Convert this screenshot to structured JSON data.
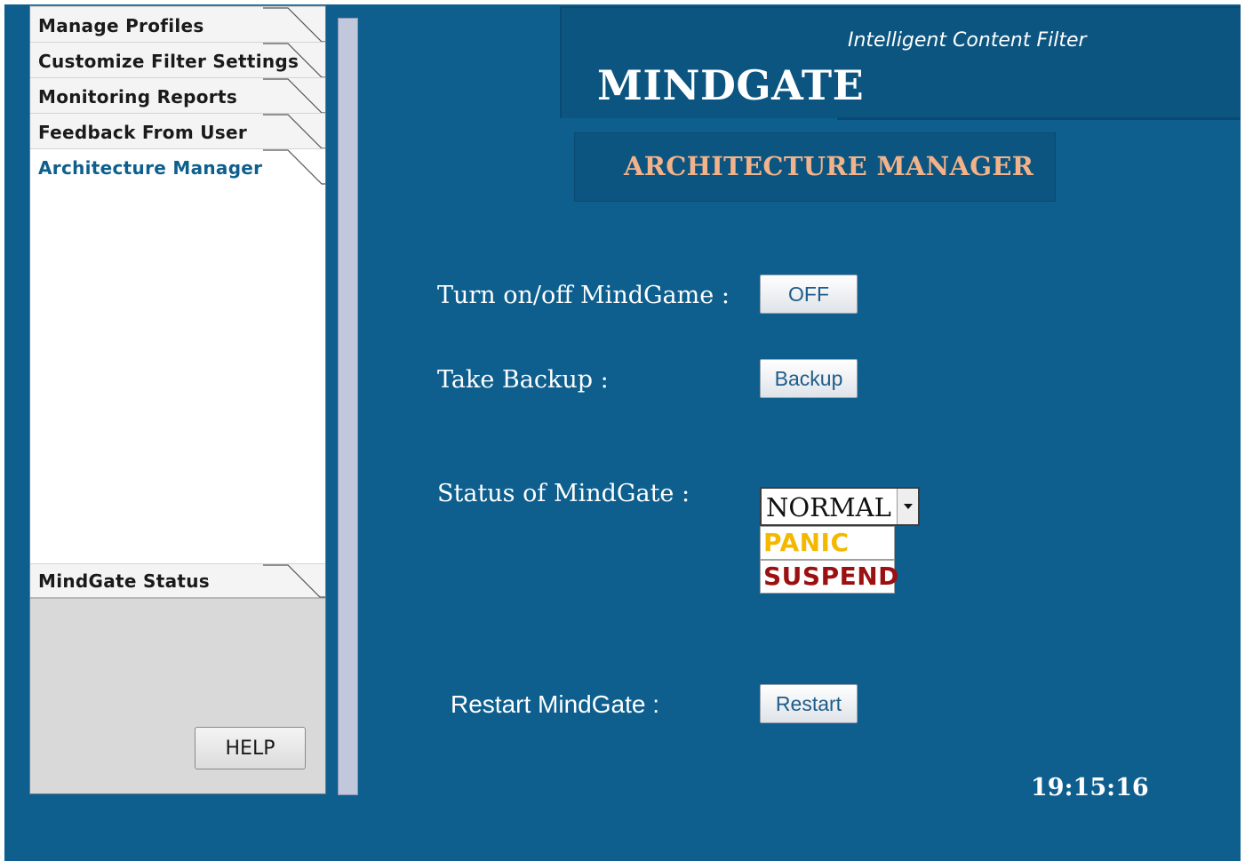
{
  "sidebar": {
    "nav": [
      {
        "label": "Manage Profiles"
      },
      {
        "label": "Customize Filter Settings"
      },
      {
        "label": "Monitoring Reports"
      },
      {
        "label": "Feedback From User"
      },
      {
        "label": "Architecture Manager"
      }
    ],
    "status_label": "MindGate Status",
    "help_label": "HELP"
  },
  "header": {
    "tagline": "Intelligent Content Filter",
    "title": "MINDGATE"
  },
  "section": {
    "title": "ARCHITECTURE MANAGER"
  },
  "form": {
    "toggle_label": "Turn on/off MindGame :",
    "toggle_button": "OFF",
    "backup_label": "Take Backup :",
    "backup_button": "Backup",
    "status_label": "Status of MindGate :",
    "status_selected": "NORMAL",
    "status_options": [
      {
        "label": "PANIC",
        "color": "#f5b800"
      },
      {
        "label": "SUSPEND",
        "color": "#9b1010"
      }
    ],
    "restart_label": "Restart MindGate :",
    "restart_button": "Restart"
  },
  "clock": "19:15:16",
  "colors": {
    "background": "#0e5f8e",
    "accent_text": "#f2b28a",
    "active_nav": "#0e5f8e"
  }
}
